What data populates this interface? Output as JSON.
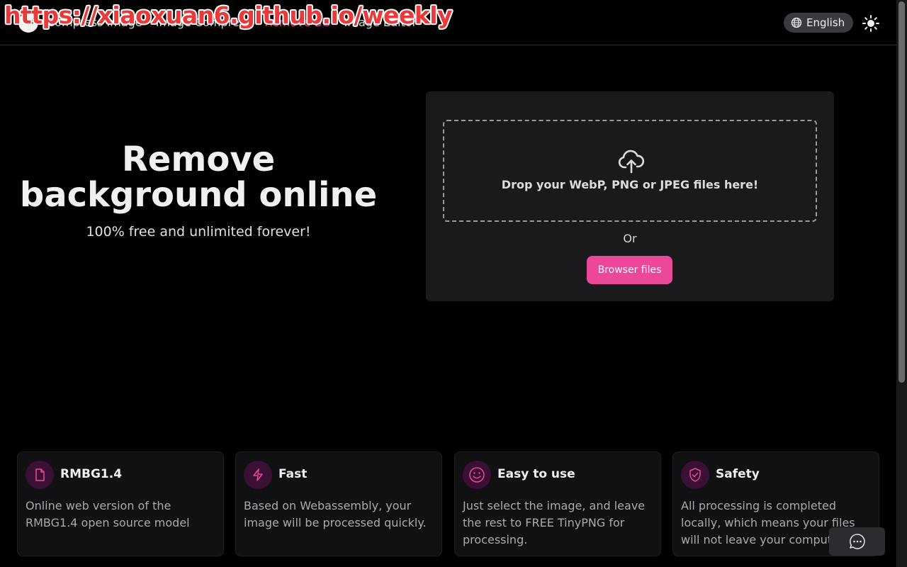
{
  "header": {
    "logo_text": "BG",
    "nav": [
      "Compress Image",
      "Image Compress",
      "Remove BG",
      "Image Editor"
    ],
    "nav_visible_tail": "Editor",
    "active_index": 2,
    "watermark": "https://xiaoxuan6.github.io/weekly",
    "language": "English"
  },
  "hero": {
    "title_line1": "Remove",
    "title_line2": "background online",
    "subtitle": "100% free and unlimited forever!"
  },
  "upload": {
    "drop_text": "Drop your WebP, PNG or JPEG files here!",
    "or_text": "Or",
    "browse_label": "Browser files"
  },
  "features": [
    {
      "title": "RMBG1.4",
      "desc": "Online web version of the RMBG1.4 open source model",
      "icon": "file-icon"
    },
    {
      "title": "Fast",
      "desc": "Based on Webassembly, your image will be processed quickly.",
      "icon": "lightning-icon"
    },
    {
      "title": "Easy to use",
      "desc": "Just select the image, and leave the rest to FREE TinyPNG for processing.",
      "icon": "smile-icon"
    },
    {
      "title": "Safety",
      "desc": "All processing is completed locally, which means your files will not leave your computer.",
      "icon": "shield-check-icon"
    }
  ],
  "colors": {
    "accent": "#ec4899",
    "background": "#000000",
    "panel": "#1a1a1d"
  }
}
